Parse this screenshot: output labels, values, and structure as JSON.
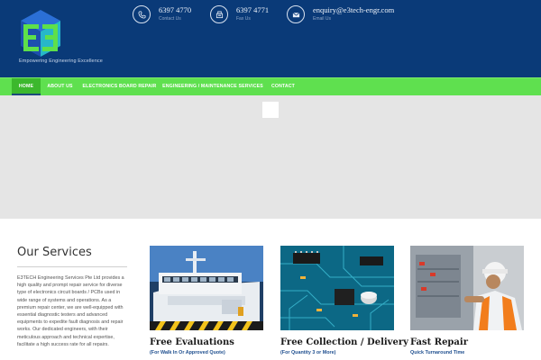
{
  "brand": {
    "tagline": "Empowering Engineering Excellence"
  },
  "contacts": [
    {
      "icon": "phone-icon",
      "value": "6397 4770",
      "label": "Contact Us"
    },
    {
      "icon": "fax-icon",
      "value": "6397 4771",
      "label": "Fax Us"
    },
    {
      "icon": "email-icon",
      "value": "enquiry@e3tech-engr.com",
      "label": "Email Us"
    }
  ],
  "nav": {
    "items": [
      {
        "label": "HOME",
        "active": true
      },
      {
        "label": "ABOUT US"
      },
      {
        "label": "ELECTRONICS BOARD REPAIR"
      },
      {
        "label": "ENGINEERING / MAINTENANCE SERVICES"
      },
      {
        "label": "CONTACT"
      }
    ]
  },
  "services": {
    "title": "Our Services",
    "body": "E3TECH Engineering Services Pte Ltd provides a high quality and prompt repair service for diverse type of electronics circuit boards / PCBs used in wide range of systems and operations. As a premium repair center, we are well-equipped with essential diagnostic testers and advanced equipments to expedite fault diagnosis and repair works. Our dedicated engineers, with their meticulous approach and technical expertise, facilitate a high success rate for all repairs."
  },
  "cards": [
    {
      "title": "Free Evaluations",
      "subtitle": "(For Walk In Or Approved Quote)"
    },
    {
      "title": "Free Collection / Delivery",
      "subtitle": "(For Quantity 3 or More)"
    },
    {
      "title": "Fast Repair",
      "subtitle": "Quick Turnaround Time"
    }
  ],
  "colors": {
    "header_bg": "#0a3a78",
    "nav_bg": "#5fe04f",
    "nav_active": "#3cb82d",
    "card_subtitle": "#1f4f8f"
  }
}
